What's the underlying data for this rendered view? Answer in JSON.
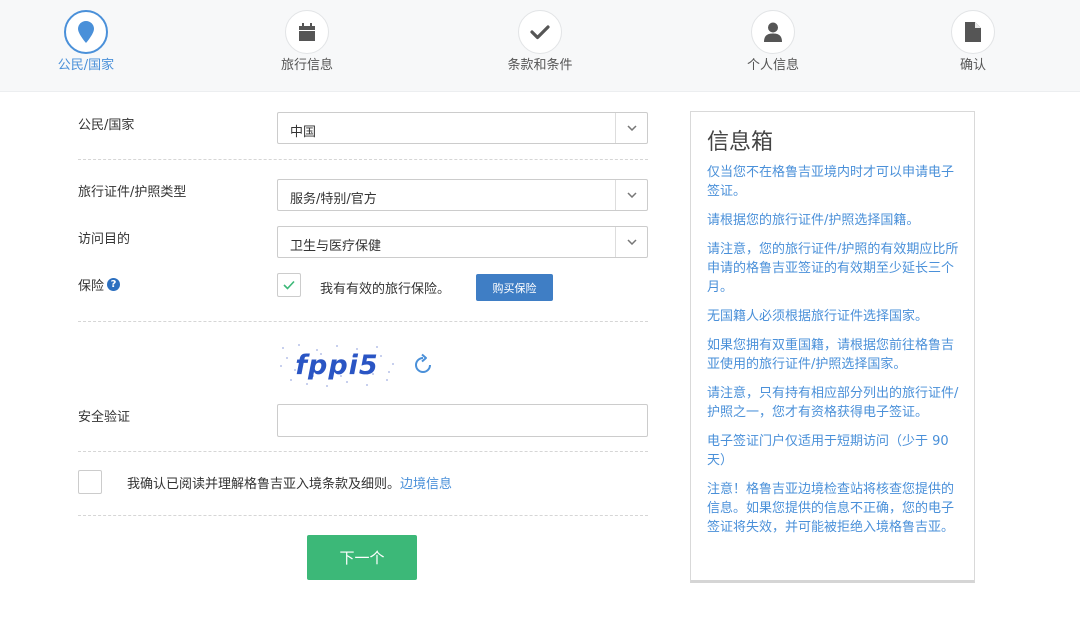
{
  "steps": [
    {
      "label": "公民/国家",
      "icon": "location-pin-icon",
      "active": true
    },
    {
      "label": "旅行信息",
      "icon": "calendar-icon",
      "active": false
    },
    {
      "label": "条款和条件",
      "icon": "checkmark-icon",
      "active": false
    },
    {
      "label": "个人信息",
      "icon": "user-icon",
      "active": false
    },
    {
      "label": "确认",
      "icon": "document-icon",
      "active": false
    }
  ],
  "form": {
    "citizenship_label": "公民/国家",
    "citizenship_value": "中国",
    "doc_type_label": "旅行证件/护照类型",
    "doc_type_value": "服务/特别/官方",
    "purpose_label": "访问目的",
    "purpose_value": "卫生与医疗保健",
    "insurance_label": "保险",
    "insurance_checked": true,
    "insurance_text": "我有有效的旅行保险。",
    "buy_insurance_label": "购买保险",
    "captcha_text": "fppi5",
    "security_label": "安全验证",
    "security_value": "",
    "agree_checked": false,
    "agree_text": "我确认已阅读并理解格鲁吉亚入境条款及细则。",
    "agree_link": "边境信息",
    "next_label": "下一个"
  },
  "infobox": {
    "title": "信息箱",
    "items": [
      "仅当您不在格鲁吉亚境内时才可以申请电子签证。",
      "请根据您的旅行证件/护照选择国籍。",
      "请注意，您的旅行证件/护照的有效期应比所申请的格鲁吉亚签证的有效期至少延长三个月。",
      "无国籍人必须根据旅行证件选择国家。",
      "如果您拥有双重国籍，请根据您前往格鲁吉亚使用的旅行证件/护照选择国家。",
      "请注意，只有持有相应部分列出的旅行证件/护照之一，您才有资格获得电子签证。",
      "电子签证门户仅适用于短期访问（少于 90 天）",
      "注意！格鲁吉亚边境检查站将核查您提供的信息。如果您提供的信息不正确，您的电子签证将失效，并可能被拒绝入境格鲁吉亚。"
    ]
  },
  "colors": {
    "accent": "#4a90d9",
    "button_blue": "#3f7ec5",
    "button_green": "#3cb878",
    "step_icon": "#555555"
  }
}
